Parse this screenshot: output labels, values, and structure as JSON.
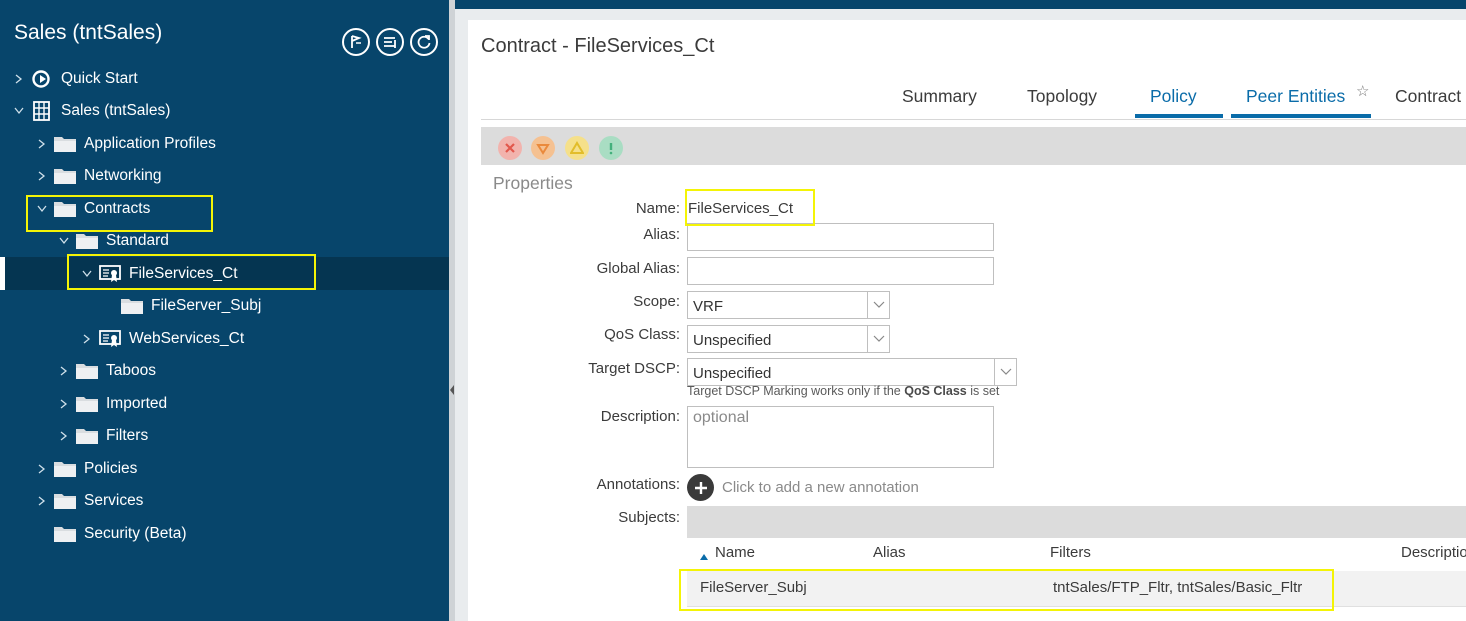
{
  "nav": {
    "title": "Sales (tntSales)",
    "header_icons": [
      "flag-icon",
      "collapse-list-icon",
      "refresh-icon"
    ],
    "items": [
      {
        "label": "Quick Start",
        "icon": "quick-start-icon"
      },
      {
        "label": "Sales (tntSales)",
        "icon": "tenant-icon"
      },
      {
        "label": "Application Profiles",
        "icon": "folder-icon"
      },
      {
        "label": "Networking",
        "icon": "folder-icon"
      },
      {
        "label": "Contracts",
        "icon": "folder-icon"
      },
      {
        "label": "Standard",
        "icon": "folder-icon"
      },
      {
        "label": "FileServices_Ct",
        "icon": "contract-icon"
      },
      {
        "label": "FileServer_Subj",
        "icon": "folder-icon"
      },
      {
        "label": "WebServices_Ct",
        "icon": "contract-icon"
      },
      {
        "label": "Taboos",
        "icon": "folder-icon"
      },
      {
        "label": "Imported",
        "icon": "folder-icon"
      },
      {
        "label": "Filters",
        "icon": "folder-icon"
      },
      {
        "label": "Policies",
        "icon": "folder-icon"
      },
      {
        "label": "Services",
        "icon": "folder-icon"
      },
      {
        "label": "Security (Beta)",
        "icon": "folder-icon"
      }
    ]
  },
  "main": {
    "title": "Contract - FileServices_Ct",
    "tabs": [
      {
        "label": "Summary",
        "active": false
      },
      {
        "label": "Topology",
        "active": false
      },
      {
        "label": "Policy",
        "active": true
      },
      {
        "label": "Peer Entities",
        "active": true
      },
      {
        "label": "Contract",
        "active": false
      }
    ],
    "fault_icons": [
      "critical-fault-icon",
      "major-fault-icon",
      "minor-fault-icon",
      "warning-fault-icon"
    ],
    "properties_title": "Properties",
    "form": {
      "name_label": "Name:",
      "name_value": "FileServices_Ct",
      "alias_label": "Alias:",
      "alias_value": "",
      "global_alias_label": "Global Alias:",
      "global_alias_value": "",
      "scope_label": "Scope:",
      "scope_value": "VRF",
      "qos_label": "QoS Class:",
      "qos_value": "Unspecified",
      "dscp_label": "Target DSCP:",
      "dscp_value": "Unspecified",
      "dscp_hint_pre": "Target DSCP Marking works only if the ",
      "dscp_hint_bold": "QoS Class",
      "dscp_hint_post": " is set",
      "description_label": "Description:",
      "description_placeholder": "optional",
      "annotations_label": "Annotations:",
      "annotations_add": "Click to add a new annotation",
      "subjects_label": "Subjects:"
    },
    "subjects_table": {
      "columns": [
        "Name",
        "Alias",
        "Filters",
        "Description"
      ],
      "rows": [
        {
          "name": "FileServer_Subj",
          "alias": "",
          "filters": "tntSales/FTP_Fltr, tntSales/Basic_Fltr",
          "description": ""
        }
      ]
    }
  },
  "colors": {
    "nav_bg": "#07456b",
    "nav_selected": "#053551",
    "accent": "#0a6ca9",
    "highlight": "#f4f406"
  }
}
